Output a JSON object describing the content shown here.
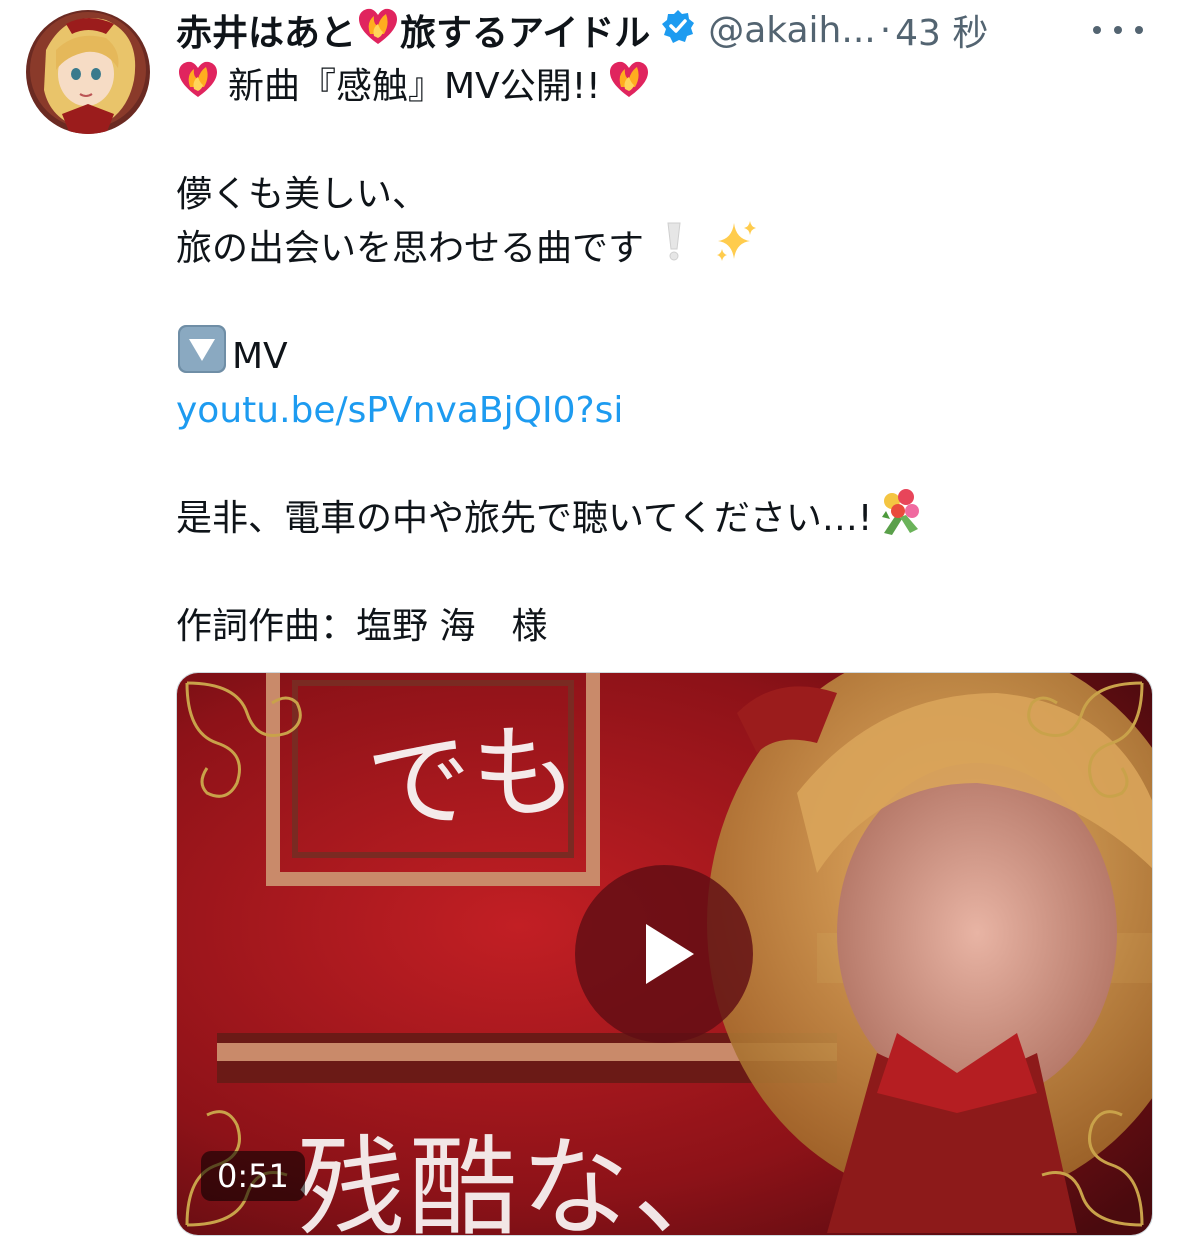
{
  "tweet": {
    "author": {
      "name_part1": "赤井はあと",
      "name_part2": "旅するアイドル",
      "handle": "@akaih...",
      "verified": true,
      "heart_emoji": "heart-on-fire-emoji"
    },
    "separator": "·",
    "time": "43 秒",
    "more_icon": "more-horizontal-icon",
    "lines": {
      "title": "新曲『感触』MV公開!!",
      "l1": "儚くも美しい、",
      "l2": "旅の出会いを思わせる曲です",
      "mv_label": "MV",
      "link": "youtu.be/sPVnvaBjQI0?si",
      "l3": "是非、電車の中や旅先で聴いてください…!",
      "credit": "作詞作曲：塩野 海　様"
    },
    "media": {
      "type": "video",
      "duration": "0:51",
      "caption_top": "でも",
      "caption_bottom": "残酷な、",
      "play_icon": "play-icon"
    }
  },
  "colors": {
    "text": "#0f1419",
    "secondary": "#536471",
    "link": "#1d9bf0",
    "verified": "#1d9bf0"
  }
}
